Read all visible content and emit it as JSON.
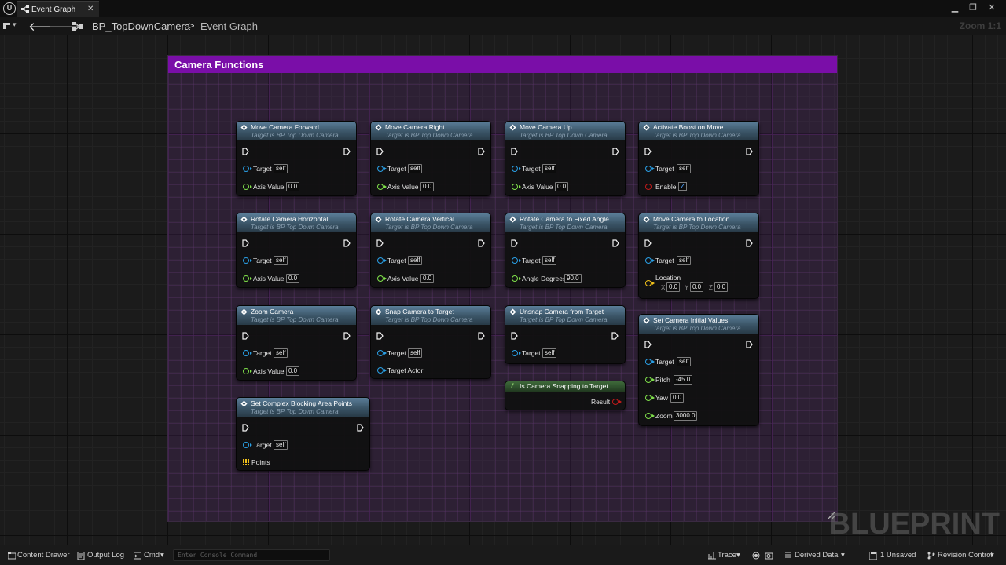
{
  "window": {
    "logo": "U",
    "tab_title": "Event Graph",
    "tab_close": "✕",
    "minimize": "▁",
    "restore": "❐",
    "close": "✕"
  },
  "toolbar": {
    "back": "🡐",
    "forward": "🡒",
    "breadcrumb": [
      "BP_TopDownCamera",
      "Event Graph"
    ],
    "separator": ">",
    "zoom": "Zoom 1:1"
  },
  "comment": {
    "title": "Camera Functions",
    "color": "#7a0ea8"
  },
  "watermark": "BLUEPRINT",
  "target_subtitle": "Target is BP Top Down Camera",
  "nodes": [
    {
      "title": "Move Camera Forward",
      "subtitle": "Target is BP Top Down Camera",
      "target_label": "Target",
      "target_value": "self",
      "param_label": "Axis Value",
      "param_value": "0.0"
    },
    {
      "title": "Move Camera Right",
      "subtitle": "Target is BP Top Down Camera",
      "target_label": "Target",
      "target_value": "self",
      "param_label": "Axis Value",
      "param_value": "0.0"
    },
    {
      "title": "Move Camera Up",
      "subtitle": "Target is BP Top Down Camera",
      "target_label": "Target",
      "target_value": "self",
      "param_label": "Axis Value",
      "param_value": "0.0"
    },
    {
      "title": "Activate Boost on Move",
      "subtitle": "Target is BP Top Down Camera",
      "target_label": "Target",
      "target_value": "self",
      "param_label": "Enable",
      "param_value": "✓"
    },
    {
      "title": "Rotate Camera Horizontal",
      "subtitle": "Target is BP Top Down Camera",
      "target_label": "Target",
      "target_value": "self",
      "param_label": "Axis Value",
      "param_value": "0.0"
    },
    {
      "title": "Rotate Camera Vertical",
      "subtitle": "Target is BP Top Down Camera",
      "target_label": "Target",
      "target_value": "self",
      "param_label": "Axis Value",
      "param_value": "0.0"
    },
    {
      "title": "Rotate Camera to Fixed Angle",
      "subtitle": "Target is BP Top Down Camera",
      "target_label": "Target",
      "target_value": "self",
      "param_label": "Angle Degrees",
      "param_value": "90.0"
    },
    {
      "title": "Move Camera to Location",
      "subtitle": "Target is BP Top Down Camera",
      "target_label": "Target",
      "target_value": "self",
      "param_label": "Location",
      "x_label": "X",
      "x_value": "0.0",
      "y_label": "Y",
      "y_value": "0.0",
      "z_label": "Z",
      "z_value": "0.0"
    },
    {
      "title": "Zoom Camera",
      "subtitle": "Target is BP Top Down Camera",
      "target_label": "Target",
      "target_value": "self",
      "param_label": "Axis Value",
      "param_value": "0.0"
    },
    {
      "title": "Snap Camera to Target",
      "subtitle": "Target is BP Top Down Camera",
      "target_label": "Target",
      "target_value": "self",
      "param_label": "Target Actor"
    },
    {
      "title": "Unsnap Camera from Target",
      "subtitle": "Target is BP Top Down Camera",
      "target_label": "Target",
      "target_value": "self"
    },
    {
      "title": "Is Camera Snapping to Target",
      "func_glyph": "f",
      "output_label": "Result"
    },
    {
      "title": "Set Camera Initial Values",
      "subtitle": "Target is BP Top Down Camera",
      "target_label": "Target",
      "target_value": "self",
      "pitch_label": "Pitch",
      "pitch_value": "-45.0",
      "yaw_label": "Yaw",
      "yaw_value": "0.0",
      "zoom_label": "Zoom",
      "zoom_value": "3000.0"
    },
    {
      "title": "Set Complex Blocking Area Points",
      "subtitle": "Target is BP Top Down Camera",
      "target_label": "Target",
      "target_value": "self",
      "param_label": "Points"
    }
  ],
  "statusbar": {
    "content_drawer": "Content Drawer",
    "output_log": "Output Log",
    "cmd": "Cmd",
    "console_placeholder": "Enter Console Command",
    "trace": "Trace",
    "derived_data": "Derived Data",
    "unsaved": "1 Unsaved",
    "revision_control": "Revision Control"
  }
}
